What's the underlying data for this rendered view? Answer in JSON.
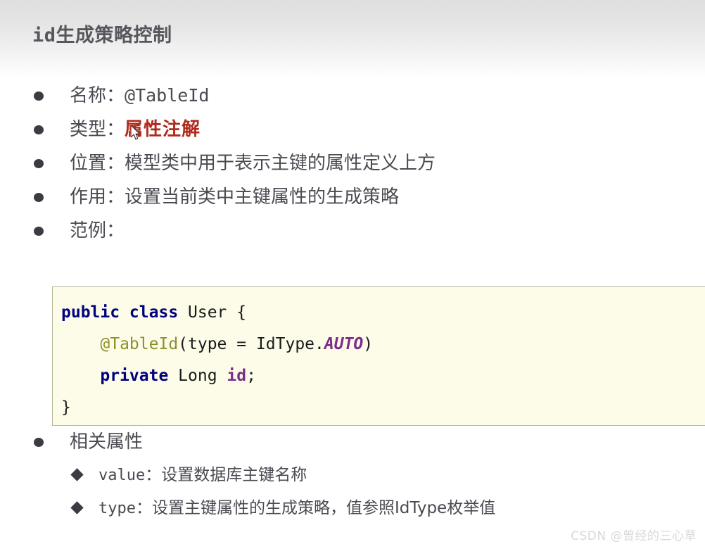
{
  "slide": {
    "title": "id生成策略控制",
    "accent_red": "#b02a1d",
    "title_color": "#56565c",
    "code_bg": "#fcfce8"
  },
  "bullets": [
    {
      "label": "名称：",
      "value": "@TableId",
      "value_style": "mono"
    },
    {
      "label": "类型：",
      "value": "属性注解",
      "value_style": "red-bold"
    },
    {
      "label": "位置：",
      "value": "模型类中用于表示主键的属性定义上方",
      "value_style": "plain"
    },
    {
      "label": "作用：",
      "value": "设置当前类中主键属性的生成策略",
      "value_style": "plain"
    },
    {
      "label": "范例：",
      "value": "",
      "value_style": "plain"
    }
  ],
  "code": {
    "language": "java",
    "lines": [
      [
        {
          "t": "public class ",
          "c": "kw"
        },
        {
          "t": "User {",
          "c": "plain"
        }
      ],
      [
        {
          "t": "    ",
          "c": "plain"
        },
        {
          "t": "@TableId",
          "c": "ann"
        },
        {
          "t": "(type = IdType.",
          "c": "plain"
        },
        {
          "t": "AUTO",
          "c": "cnst"
        },
        {
          "t": ")",
          "c": "plain"
        }
      ],
      [
        {
          "t": "    ",
          "c": "plain"
        },
        {
          "t": "private ",
          "c": "kw"
        },
        {
          "t": "Long ",
          "c": "plain"
        },
        {
          "t": "id",
          "c": "fld"
        },
        {
          "t": ";",
          "c": "plain"
        }
      ],
      [
        {
          "t": "}",
          "c": "plain"
        }
      ]
    ]
  },
  "sub_section": {
    "heading": "相关属性",
    "items": [
      {
        "name": "value",
        "sep": "：",
        "desc": "设置数据库主键名称"
      },
      {
        "name": "type",
        "sep": "：",
        "desc": "设置主键属性的生成策略，值参照IdType枚举值"
      }
    ]
  },
  "watermark": "CSDN @曾经的三心草"
}
